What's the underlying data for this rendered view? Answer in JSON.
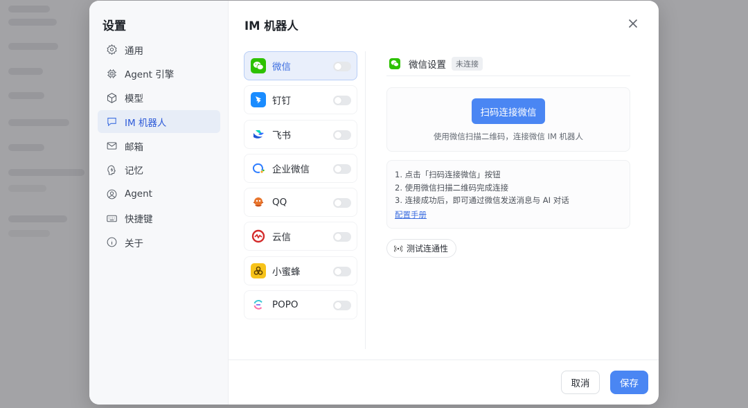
{
  "sidebar": {
    "title": "设置",
    "items": [
      {
        "label": "通用",
        "icon": "gear-icon"
      },
      {
        "label": "Agent 引擎",
        "icon": "chip-icon"
      },
      {
        "label": "模型",
        "icon": "cube-icon"
      },
      {
        "label": "IM 机器人",
        "icon": "chat-bubble-icon"
      },
      {
        "label": "邮箱",
        "icon": "mail-icon"
      },
      {
        "label": "记忆",
        "icon": "brain-icon"
      },
      {
        "label": "Agent",
        "icon": "user-circle-icon"
      },
      {
        "label": "快捷键",
        "icon": "keyboard-icon"
      },
      {
        "label": "关于",
        "icon": "info-icon"
      }
    ],
    "active_index": 3
  },
  "main": {
    "title": "IM 机器人"
  },
  "im_list": [
    {
      "label": "微信",
      "icon": "wechat-icon",
      "enabled": false
    },
    {
      "label": "钉钉",
      "icon": "dingtalk-icon",
      "enabled": false
    },
    {
      "label": "飞书",
      "icon": "feishu-icon",
      "enabled": false
    },
    {
      "label": "企业微信",
      "icon": "wecom-icon",
      "enabled": false
    },
    {
      "label": "QQ",
      "icon": "qq-icon",
      "enabled": false
    },
    {
      "label": "云信",
      "icon": "yunxin-icon",
      "enabled": false
    },
    {
      "label": "小蜜蜂",
      "icon": "bee-icon",
      "enabled": false
    },
    {
      "label": "POPO",
      "icon": "popo-icon",
      "enabled": false
    }
  ],
  "detail": {
    "title": "微信设置",
    "status": "未连接",
    "scan_button": "扫码连接微信",
    "scan_hint": "使用微信扫描二维码，连接微信 IM 机器人",
    "steps": [
      "1. 点击「扫码连接微信」按钮",
      "2. 使用微信扫描二维码完成连接",
      "3. 连接成功后，即可通过微信发送消息与 AI 对话"
    ],
    "guide_link": "配置手册",
    "test_button": "测试连通性"
  },
  "footer": {
    "cancel": "取消",
    "save": "保存"
  },
  "colors": {
    "accent": "#4a86f3",
    "wechat_green": "#2dc100"
  }
}
